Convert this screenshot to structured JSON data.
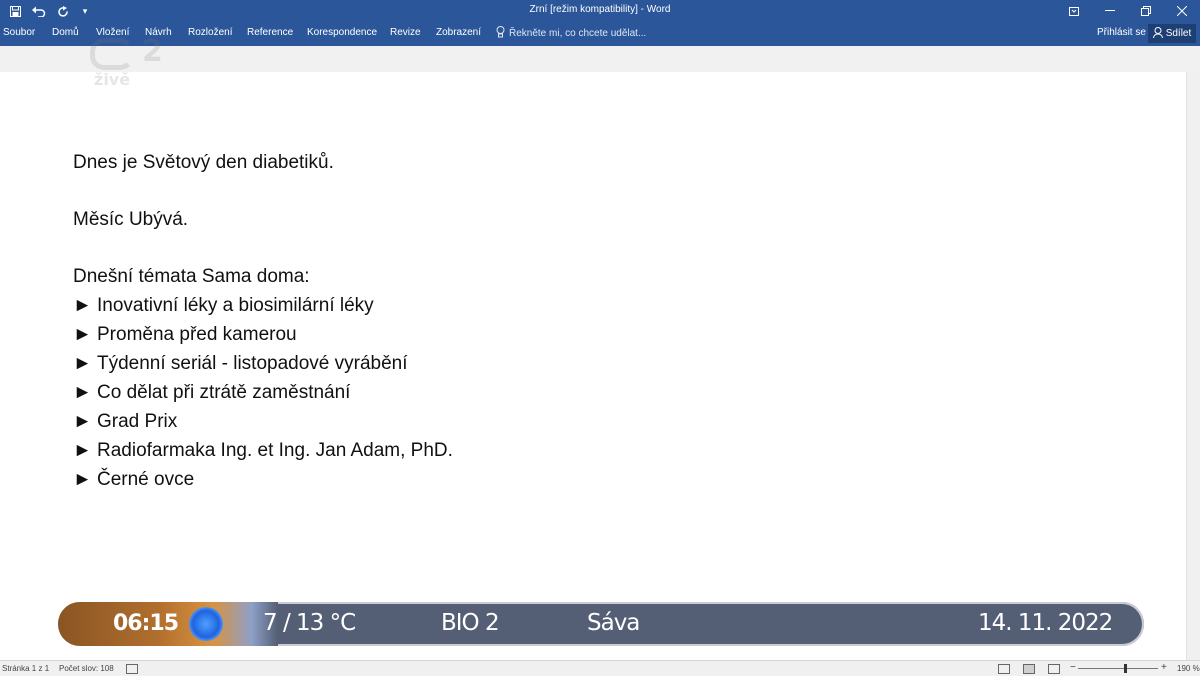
{
  "titlebar": {
    "title": "Zrní [režim kompatibility] - Word",
    "quick_access": [
      "save-icon",
      "undo-icon",
      "redo-icon",
      "customize-icon"
    ],
    "window_buttons": [
      "ribbon-display-icon",
      "minimize-icon",
      "restore-icon",
      "close-icon"
    ]
  },
  "ribbon": {
    "tabs": [
      "Soubor",
      "Domů",
      "Vložení",
      "Návrh",
      "Rozložení",
      "Reference",
      "Korespondence",
      "Revize",
      "Zobrazení"
    ],
    "tell_me": "Řekněte mi, co chcete udělat...",
    "sign_in": "Přihlásit se",
    "share": "Sdílet"
  },
  "logo": {
    "number": "2",
    "text": "živě"
  },
  "document": {
    "line1": "Dnes je Světový den diabetiků.",
    "line2": "Měsíc Ubývá.",
    "topics_heading": "Dnešní témata Sama doma:",
    "bullet_char": "►",
    "topics": [
      "Inovativní léky a biosimilární léky",
      "Proměna před kamerou",
      "Týdenní seriál - listopadové vyrábění",
      "Co dělat při ztrátě zaměstnání",
      "Grad Prix",
      "Radiofarmaka Ing. et Ing. Jan Adam, PhD.",
      "Černé ovce"
    ]
  },
  "ticker": {
    "time": "06:15",
    "weather": "7 / 13 °C",
    "channel": "BIO 2",
    "nameday": "Sáva",
    "date": "14. 11. 2022"
  },
  "statusbar": {
    "page": "Stránka 1 z 1",
    "words": "Počet slov: 108",
    "zoom": "190 %"
  }
}
